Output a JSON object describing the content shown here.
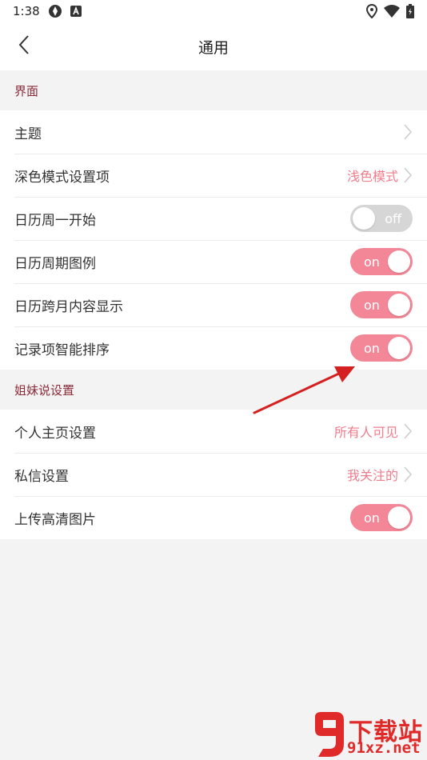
{
  "status_bar": {
    "time": "1:38"
  },
  "header": {
    "title": "通用"
  },
  "sections": [
    {
      "title": "界面",
      "rows": [
        {
          "label": "主题",
          "value": "",
          "type": "link"
        },
        {
          "label": "深色模式设置项",
          "value": "浅色模式",
          "type": "link"
        },
        {
          "label": "日历周一开始",
          "toggle": "off",
          "type": "toggle"
        },
        {
          "label": "日历周期图例",
          "toggle": "on",
          "type": "toggle"
        },
        {
          "label": "日历跨月内容显示",
          "toggle": "on",
          "type": "toggle"
        },
        {
          "label": "记录项智能排序",
          "toggle": "on",
          "type": "toggle"
        }
      ]
    },
    {
      "title": "姐妹说设置",
      "rows": [
        {
          "label": "个人主页设置",
          "value": "所有人可见",
          "type": "link"
        },
        {
          "label": "私信设置",
          "value": "我关注的",
          "type": "link"
        },
        {
          "label": "上传高清图片",
          "toggle": "on",
          "type": "toggle"
        }
      ]
    }
  ],
  "watermark": {
    "title": "下载站",
    "url": "91xz.net"
  },
  "colors": {
    "accent": "#f38797",
    "section_title": "#8a2c3a",
    "value_text": "#f07c8c",
    "toggle_off": "#d6d6d6",
    "arrow": "#d42020"
  }
}
